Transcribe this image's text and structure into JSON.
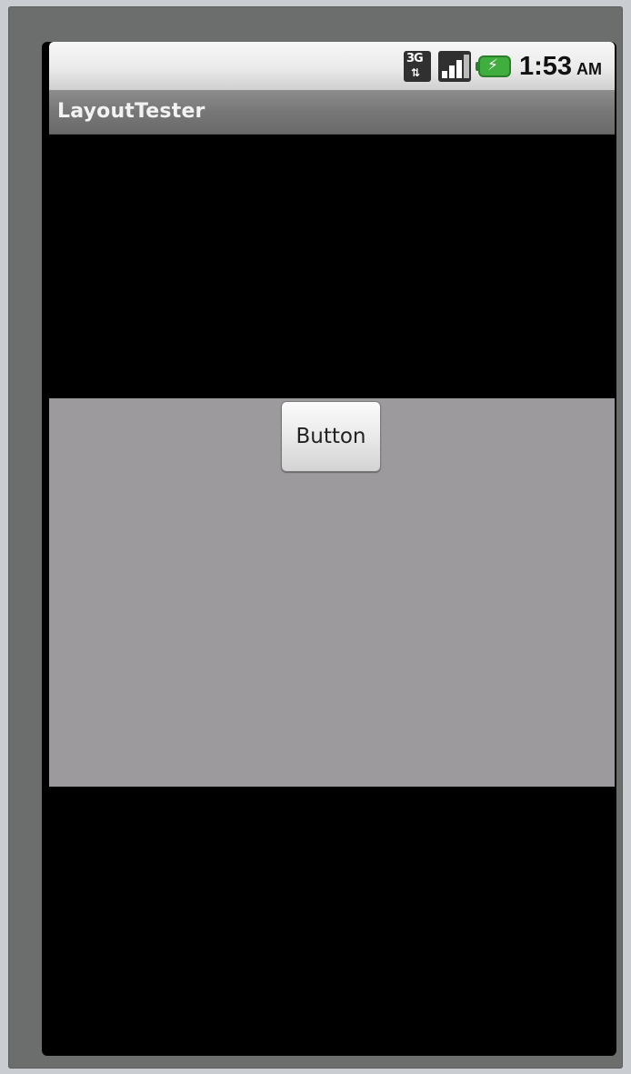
{
  "status_bar": {
    "network_type": "3G",
    "network_arrows": "⇅",
    "time": "1:53",
    "ampm": "AM",
    "icons": [
      "network-3g-icon",
      "signal-strength-icon",
      "battery-charging-icon"
    ],
    "battery_color": "#3fae3f"
  },
  "app": {
    "title": "LayoutTester"
  },
  "layout": {
    "panel_color": "#9d9a9d",
    "background_color": "#000000"
  },
  "button": {
    "label": "Button"
  }
}
